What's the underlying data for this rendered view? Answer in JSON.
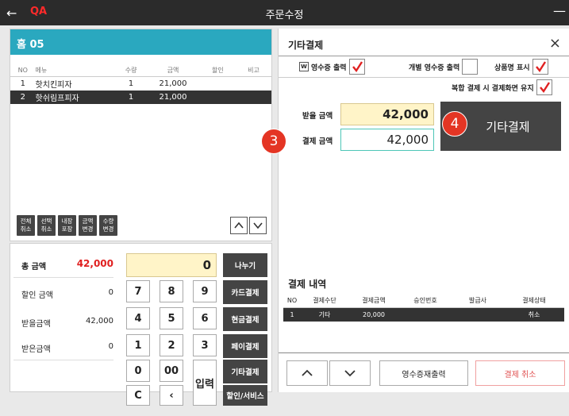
{
  "titlebar": {
    "back_icon": "←",
    "tag": "QA",
    "title": "주문수정",
    "minimize_icon": "—"
  },
  "table_panel": {
    "table_name": "홈 05"
  },
  "order_table": {
    "headers": [
      "NO",
      "메뉴",
      "수량",
      "금액",
      "할인",
      "비고"
    ],
    "rows": [
      {
        "no": "1",
        "menu": "핫치킨피자",
        "qty": "1",
        "amount": "21,000",
        "discount": "",
        "note": ""
      },
      {
        "no": "2",
        "menu": "핫쉬림프피자",
        "qty": "1",
        "amount": "21,000",
        "discount": "",
        "note": ""
      }
    ]
  },
  "order_ops": [
    {
      "line1": "전체",
      "line2": "취소"
    },
    {
      "line1": "선택",
      "line2": "취소"
    },
    {
      "line1": "내장",
      "line2": "포장"
    },
    {
      "line1": "금액",
      "line2": "변경"
    },
    {
      "line1": "수량",
      "line2": "변경"
    }
  ],
  "summary": {
    "total_label": "총 금액",
    "total": "42,000",
    "discount_label": "할인 금액",
    "discount": "0",
    "due_label": "받을금액",
    "due": "42,000",
    "received_label": "받은금액",
    "received": "0"
  },
  "keypad": {
    "display": "0",
    "keys": [
      "7",
      "8",
      "9",
      "4",
      "5",
      "6",
      "1",
      "2",
      "3",
      "0",
      "00",
      "C",
      "‹"
    ],
    "enter": "입력"
  },
  "side_buttons": [
    "나누기",
    "카드결제",
    "현금결제",
    "페이결제",
    "기타결제",
    "할인/서비스"
  ],
  "other_payment": {
    "title": "기타결제",
    "close_icon": "×",
    "receipt_icon": "W",
    "opt_receipt": "영수증 출력",
    "opt_individual": "개별 영수증 출력",
    "opt_product_name": "상품명 표시",
    "opt_keep": "복합 결제 시 결제화면 유지",
    "due_label": "받을 금액",
    "due_value": "42,000",
    "pay_label": "결제 금액",
    "pay_value": "42,000",
    "pay_button": "기타결제",
    "badge_3": "3",
    "badge_4": "4"
  },
  "history": {
    "title": "결제 내역",
    "headers": [
      "NO",
      "결제수단",
      "결제금액",
      "승인번호",
      "발급사",
      "결제상태"
    ],
    "rows": [
      {
        "no": "1",
        "method": "기타",
        "amount": "20,000",
        "approval": "",
        "issuer": "",
        "status": "취소"
      }
    ]
  },
  "footer": {
    "reprint": "영수증재출력",
    "cancel": "결제 취소"
  },
  "colors": {
    "accent": "#2aa8bf",
    "check": "#e02020",
    "badge": "#e43524",
    "cancel": "#e05050"
  }
}
